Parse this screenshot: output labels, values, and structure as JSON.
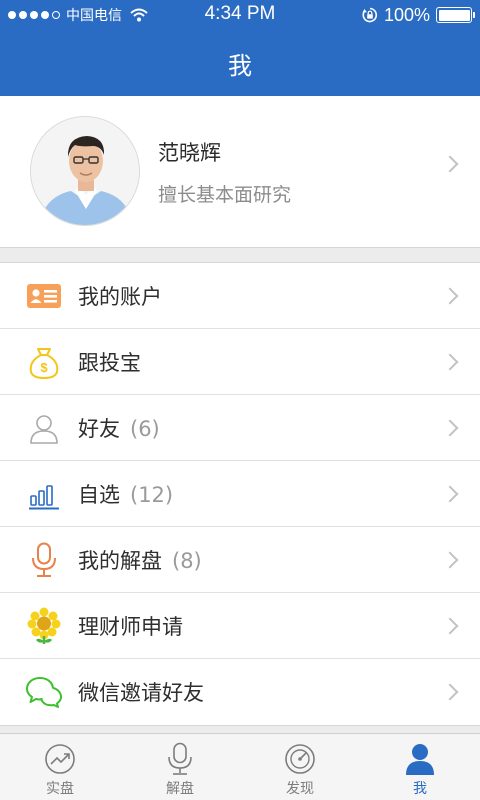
{
  "status_bar": {
    "carrier": "中国电信",
    "time": "4:34 PM",
    "battery": "100%"
  },
  "nav": {
    "title": "我"
  },
  "profile": {
    "name": "范晓辉",
    "description": "擅长基本面研究"
  },
  "menu": {
    "items": [
      {
        "label": "我的账户",
        "count": "",
        "icon": "id-card-icon"
      },
      {
        "label": "跟投宝",
        "count": "",
        "icon": "money-bag-icon"
      },
      {
        "label": "好友",
        "count": "(6)",
        "icon": "person-icon"
      },
      {
        "label": "自选",
        "count": "(12)",
        "icon": "bar-chart-icon"
      },
      {
        "label": "我的解盘",
        "count": "(8)",
        "icon": "microphone-icon"
      },
      {
        "label": "理财师申请",
        "count": "",
        "icon": "sunflower-icon"
      },
      {
        "label": "微信邀请好友",
        "count": "",
        "icon": "wechat-icon"
      }
    ]
  },
  "tabbar": {
    "tabs": [
      {
        "label": "实盘",
        "icon": "trend-chart-icon",
        "active": false
      },
      {
        "label": "解盘",
        "icon": "microphone-icon",
        "active": false
      },
      {
        "label": "发现",
        "icon": "compass-icon",
        "active": false
      },
      {
        "label": "我",
        "icon": "user-icon",
        "active": true
      }
    ]
  },
  "colors": {
    "brand_blue": "#2a6cc3",
    "account_orange": "#f7a05a",
    "bag_yellow": "#f3c61a",
    "chart_blue": "#2a6cc3",
    "mic_orange": "#e8824a",
    "wechat_green": "#3dbf2e",
    "sunflower_yellow": "#f7d21c"
  }
}
